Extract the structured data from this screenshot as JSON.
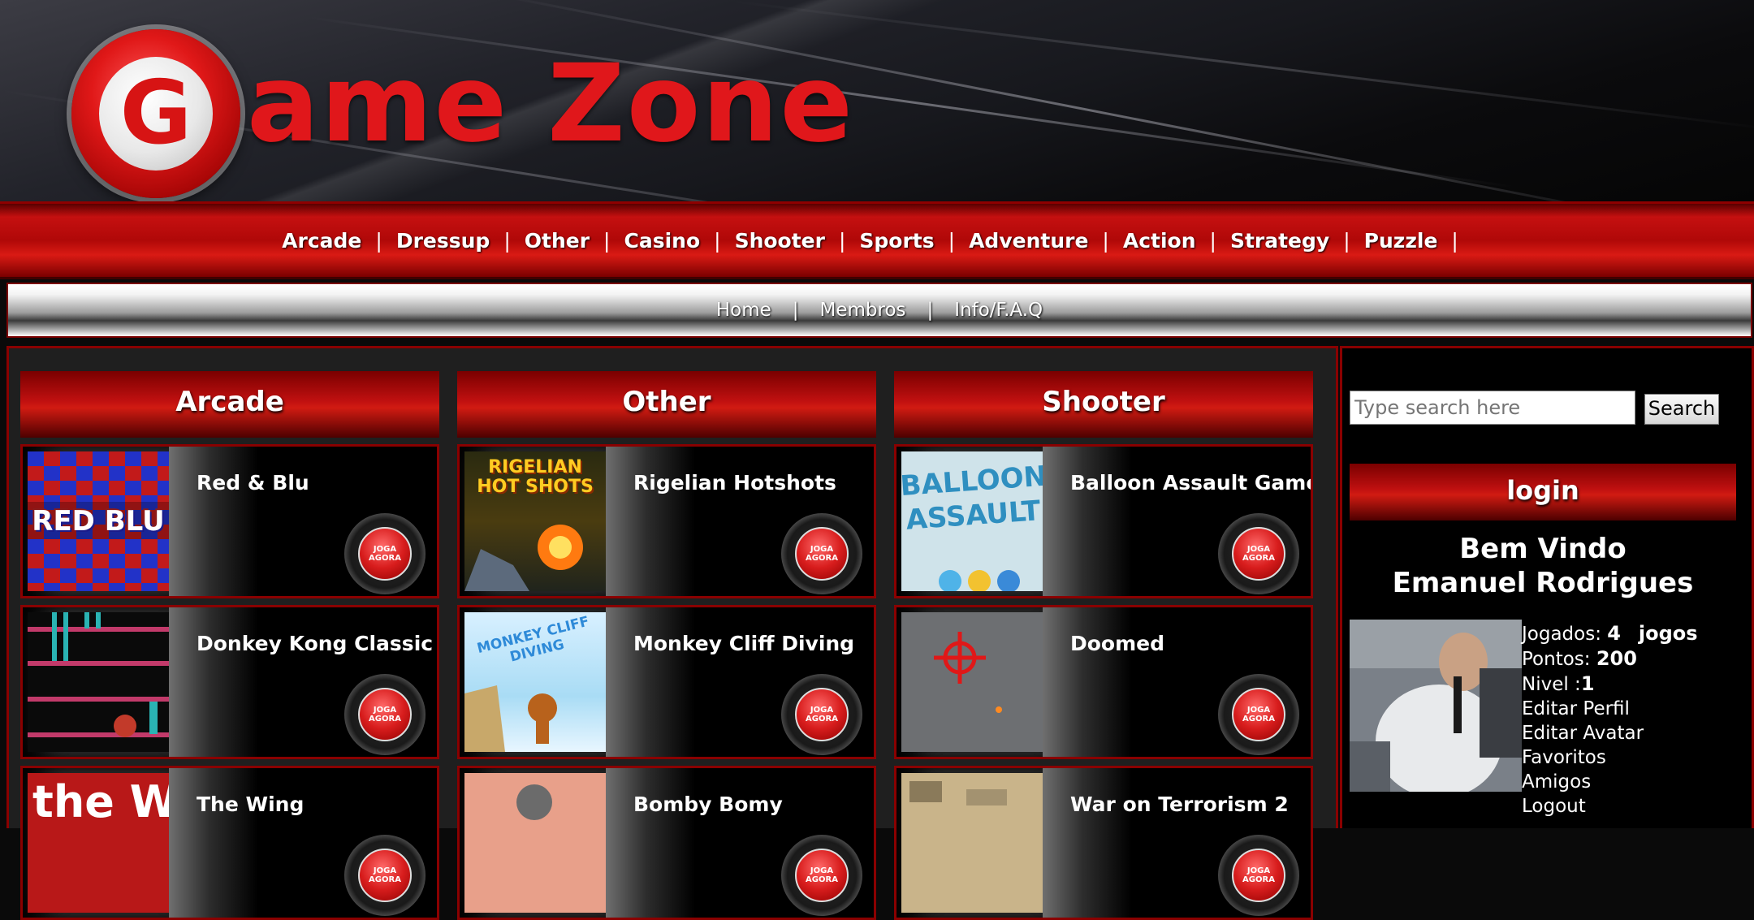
{
  "site": {
    "logo_letter": "G",
    "logo_rest": "ame Zone"
  },
  "categories": [
    "Arcade",
    "Dressup",
    "Other",
    "Casino",
    "Shooter",
    "Sports",
    "Adventure",
    "Action",
    "Strategy",
    "Puzzle"
  ],
  "subnav": [
    "Home",
    "Membros",
    "Info/F.A.Q"
  ],
  "play_label_1": "JOGA",
  "play_label_2": "AGORA",
  "columns": [
    {
      "title": "Arcade",
      "games": [
        "Red & Blu",
        "Donkey Kong Classic",
        "The Wing"
      ]
    },
    {
      "title": "Other",
      "games": [
        "Rigelian Hotshots",
        "Monkey Cliff Diving",
        "Bomby Bomy"
      ]
    },
    {
      "title": "Shooter",
      "games": [
        "Balloon Assault Game",
        "Doomed",
        "War on Terrorism 2"
      ]
    }
  ],
  "thumb_text": {
    "red_blu": "RED BLU",
    "rigelian": "RIGELIAN\nHOT SHOTS",
    "balloon": "BALLOON\nASSAULT",
    "the_wing": "the W",
    "monkey": "MONKEY CLIFF DIVING"
  },
  "sidebar": {
    "search_placeholder": "Type search here",
    "search_button": "Search",
    "login_title": "login",
    "welcome_line1": "Bem Vindo",
    "welcome_line2": "Emanuel Rodrigues",
    "played_label": "Jogados:",
    "played_value": "4",
    "played_unit": "jogos",
    "points_label": "Pontos:",
    "points_value": "200",
    "level_label": "Nivel :",
    "level_value": "1",
    "links": [
      "Editar Perfil",
      "Editar Avatar",
      "Favoritos",
      "Amigos",
      "Logout"
    ]
  }
}
